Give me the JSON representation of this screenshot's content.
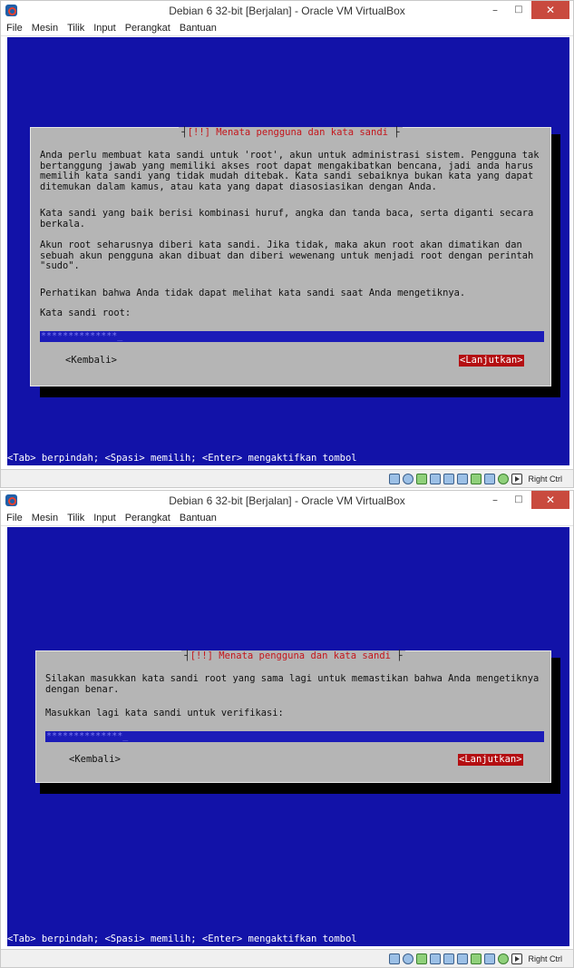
{
  "window": {
    "title": "Debian 6 32-bit [Berjalan] - Oracle VM VirtualBox",
    "min_glyph": "–",
    "max_glyph": "□",
    "close_glyph": "✕"
  },
  "menu": [
    "File",
    "Mesin",
    "Tilik",
    "Input",
    "Perangkat",
    "Bantuan"
  ],
  "dialog_title": "[!!] Menata pengguna dan kata sandi",
  "screen1": {
    "paragraphs": [
      "Anda perlu membuat kata sandi untuk 'root', akun untuk administrasi sistem. Pengguna tak bertanggung jawab yang memiliki akses root dapat mengakibatkan bencana, jadi anda harus memilih kata sandi yang tidak mudah ditebak. Kata sandi sebaiknya bukan kata yang dapat ditemukan dalam kamus, atau kata yang dapat diasosiasikan dengan Anda.",
      "Kata sandi yang baik berisi kombinasi huruf, angka dan tanda baca, serta diganti secara berkala.",
      "Akun root seharusnya diberi kata sandi. Jika tidak, maka akun root akan dimatikan dan sebuah akun pengguna akan dibuat dan diberi wewenang untuk menjadi root dengan perintah \"sudo\".",
      "Perhatikan bahwa Anda tidak dapat melihat kata sandi saat Anda mengetiknya.",
      "Kata sandi root:"
    ],
    "password_value": "**************_",
    "back_label": "<Kembali>",
    "next_label": "<Lanjutkan>"
  },
  "screen2": {
    "paragraphs": [
      "Silakan masukkan kata sandi root yang sama lagi untuk memastikan bahwa Anda mengetiknya dengan benar.",
      "Masukkan lagi kata sandi untuk verifikasi:"
    ],
    "password_value": "**************_",
    "back_label": "<Kembali>",
    "next_label": "<Lanjutkan>"
  },
  "hint": "<Tab> berpindah; <Spasi> memilih; <Enter> mengaktifkan tombol",
  "host_key": "Right Ctrl",
  "status_icons": [
    "hard-disk-icon",
    "optical-drive-icon",
    "usb-icon",
    "shared-folders-icon",
    "display-icon",
    "network-icon",
    "network-adapter-icon",
    "video-capture-icon",
    "cpu-virtualization-icon",
    "mouse-integration-icon"
  ],
  "colors": {
    "screen_bg": "#1212a8",
    "dialog_bg": "#b5b5b5",
    "title_red": "#c4161c",
    "button_selected": "#b40f12",
    "input_blue": "#1c1cb8"
  }
}
